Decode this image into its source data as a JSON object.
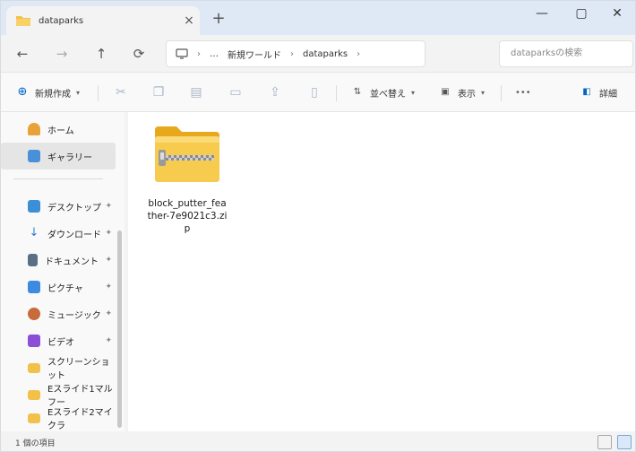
{
  "window": {
    "tab_title": "dataparks",
    "tab_close": "×",
    "new_tab": "+",
    "controls": {
      "minimize": "—",
      "maximize": "▢",
      "close": "✕"
    }
  },
  "nav": {
    "back": "←",
    "forward": "→",
    "up": "↑",
    "refresh": "⟳",
    "breadcrumbs": [
      "新規ワールド",
      "dataparks"
    ],
    "ellipsis": "…",
    "search_placeholder": "dataparksの検索"
  },
  "commands": {
    "new_label": "新規作成",
    "sort_label": "並べ替え",
    "view_label": "表示",
    "more_label": "•••",
    "details_label": "詳細"
  },
  "sidebar": {
    "items": [
      {
        "label": "ホーム",
        "color": "#e8a23a"
      },
      {
        "label": "ギャラリー",
        "color": "#4a90d9"
      },
      {
        "label": "デスクトップ",
        "color": "#3b8fd6"
      },
      {
        "label": "ダウンロード",
        "color": "#2e7fd0"
      },
      {
        "label": "ドキュメント",
        "color": "#5a6e86"
      },
      {
        "label": "ピクチャ",
        "color": "#3d8be0"
      },
      {
        "label": "ミュージック",
        "color": "#c86b3c"
      },
      {
        "label": "ビデオ",
        "color": "#8b4fd6"
      },
      {
        "label": "スクリーンショット",
        "color": "#f2c14a"
      },
      {
        "label": "Eスライド1マルフー",
        "color": "#f2c14a"
      },
      {
        "label": "Eスライド2マイクラ",
        "color": "#f2c14a"
      }
    ]
  },
  "content": {
    "files": [
      {
        "name": "block_putter_feather-7e9021c3.zip",
        "type": "zip-folder"
      }
    ]
  },
  "status": {
    "count_text": "1 個の項目"
  },
  "colors": {
    "accent": "#0067c0",
    "folder": "#f2c14a",
    "tabstrip": "#dfe9f6"
  }
}
